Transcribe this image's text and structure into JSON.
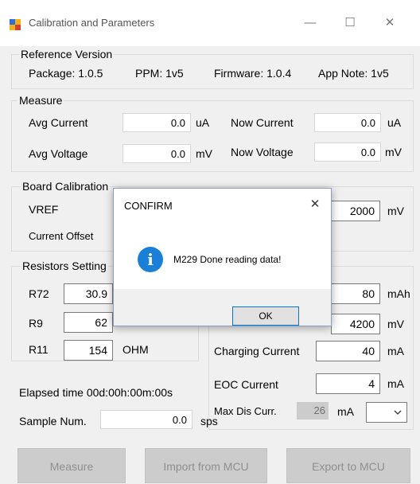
{
  "window": {
    "title": "Calibration and Parameters",
    "minimize_glyph": "—",
    "maximize_glyph": "☐",
    "close_glyph": "✕"
  },
  "reference_version": {
    "label": "Reference Version",
    "package": "Package: 1.0.5",
    "ppm": "PPM: 1v5",
    "firmware": "Firmware:  1.0.4",
    "app_note": "App Note:  1v5"
  },
  "measure": {
    "label": "Measure",
    "avg_current_label": "Avg Current",
    "avg_current_value": "0.0",
    "avg_current_unit": "uA",
    "now_current_label": "Now Current",
    "now_current_value": "0.0",
    "now_current_unit": "uA",
    "avg_voltage_label": "Avg Voltage",
    "avg_voltage_value": "0.0",
    "avg_voltage_unit": "mV",
    "now_voltage_label": "Now Voltage",
    "now_voltage_value": "0.0",
    "now_voltage_unit": "mV"
  },
  "board_calibration": {
    "label": "Board Calibration",
    "vref_label": "VREF",
    "current_offset_label": "Current Offset",
    "vref_value": "2000",
    "vref_unit": "mV"
  },
  "resistors": {
    "label": "Resistors Setting",
    "r72_label": "R72",
    "r72_value": "30.9",
    "r9_label": "R9",
    "r9_value": "62",
    "r11_label": "R11",
    "r11_value": "154",
    "r11_unit": "OHM"
  },
  "battery": {
    "capacity_value": "80",
    "capacity_unit": "mAh",
    "voltage_value": "4200",
    "voltage_unit": "mV",
    "charging_current_label": "Charging Current",
    "charging_current_value": "40",
    "charging_current_unit": "mA",
    "eoc_current_label": "EOC Current",
    "eoc_current_value": "4",
    "eoc_current_unit": "mA",
    "max_dis_label": "Max Dis Curr.",
    "max_dis_value": "26",
    "max_dis_unit": "mA"
  },
  "status": {
    "elapsed_text": "Elapsed time  00d:00h:00m:00s",
    "sample_label": "Sample Num.",
    "sample_value": "0.0",
    "sample_unit": "sps"
  },
  "buttons": {
    "measure": "Measure",
    "import": "Import from MCU",
    "export": "Export to MCU"
  },
  "dialog": {
    "title": "CONFIRM",
    "close_glyph": "✕",
    "icon_glyph": "i",
    "message": "M229 Done reading data!",
    "ok": "OK"
  },
  "colors": {
    "accent": "#0078d7",
    "info_icon": "#1a7fd6",
    "disabled_button": "#cccccc"
  }
}
